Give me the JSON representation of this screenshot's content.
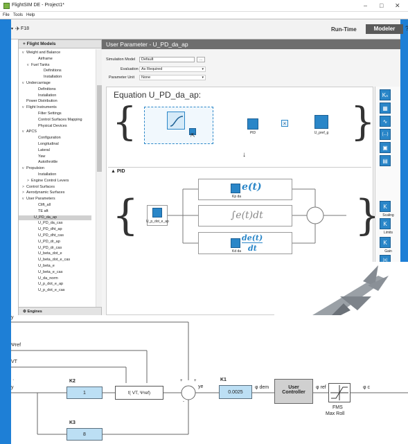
{
  "window": {
    "title": "FlightSIM DE - Project1*",
    "minimize": "–",
    "maximize": "□",
    "close": "✕"
  },
  "menu": {
    "file": "File",
    "tools": "Tools",
    "help": "Help"
  },
  "toolbar": {
    "project": "F18",
    "runtime": "Run-Time",
    "modeler": "Modeler",
    "help_icon": "?"
  },
  "sidebar": {
    "header": "Flight Models",
    "footer": "Engines",
    "items": [
      {
        "label": "Weight and Balance",
        "level": 1,
        "toggle": "v"
      },
      {
        "label": "Airframe",
        "level": 3,
        "toggle": ""
      },
      {
        "label": "Fuel Tanks",
        "level": 2,
        "toggle": "v"
      },
      {
        "label": "Definitions",
        "level": 4,
        "toggle": ""
      },
      {
        "label": "Installation",
        "level": 4,
        "toggle": ""
      },
      {
        "label": "Undercarriage",
        "level": 1,
        "toggle": "v"
      },
      {
        "label": "Definitions",
        "level": 3,
        "toggle": ""
      },
      {
        "label": "Installation",
        "level": 3,
        "toggle": ""
      },
      {
        "label": "Power Distribution",
        "level": 1,
        "toggle": ""
      },
      {
        "label": "Flight Instruments",
        "level": 1,
        "toggle": "v"
      },
      {
        "label": "Filter Settings",
        "level": 3,
        "toggle": ""
      },
      {
        "label": "Control Surfaces Mapping",
        "level": 3,
        "toggle": ""
      },
      {
        "label": "Physical Devices",
        "level": 3,
        "toggle": ""
      },
      {
        "label": "APCS",
        "level": 1,
        "toggle": "v"
      },
      {
        "label": "Configuration",
        "level": 3,
        "toggle": ""
      },
      {
        "label": "Longitudinal",
        "level": 3,
        "toggle": ""
      },
      {
        "label": "Lateral",
        "level": 3,
        "toggle": ""
      },
      {
        "label": "Yaw",
        "level": 3,
        "toggle": ""
      },
      {
        "label": "Autothrottle",
        "level": 3,
        "toggle": ""
      },
      {
        "label": "Propulsion",
        "level": 1,
        "toggle": "v"
      },
      {
        "label": "Installation",
        "level": 3,
        "toggle": ""
      },
      {
        "label": "Engine Control Levers",
        "level": 2,
        "toggle": ">"
      },
      {
        "label": "Control Surfaces",
        "level": 1,
        "toggle": ">"
      },
      {
        "label": "Aerodynamic Surfaces",
        "level": 1,
        "toggle": ">"
      },
      {
        "label": "User Parameters",
        "level": 1,
        "toggle": "v"
      },
      {
        "label": "Clift_all",
        "level": 3,
        "toggle": ""
      },
      {
        "label": "TE aft",
        "level": 3,
        "toggle": ""
      },
      {
        "label": "U_PD_da_ap",
        "level": 3,
        "toggle": "",
        "selected": true
      },
      {
        "label": "U_PD_da_cas",
        "level": 3,
        "toggle": ""
      },
      {
        "label": "U_PD_dht_ap",
        "level": 3,
        "toggle": ""
      },
      {
        "label": "U_PD_dht_cas",
        "level": 3,
        "toggle": ""
      },
      {
        "label": "U_PD_dr_ap",
        "level": 3,
        "toggle": ""
      },
      {
        "label": "U_PD_dr_cas",
        "level": 3,
        "toggle": ""
      },
      {
        "label": "U_beta_dot_e",
        "level": 3,
        "toggle": ""
      },
      {
        "label": "U_beta_dot_e_cas",
        "level": 3,
        "toggle": ""
      },
      {
        "label": "U_beta_e",
        "level": 3,
        "toggle": ""
      },
      {
        "label": "U_beta_e_cas",
        "level": 3,
        "toggle": ""
      },
      {
        "label": "U_da_norm",
        "level": 3,
        "toggle": ""
      },
      {
        "label": "U_p_dot_e_ap",
        "level": 3,
        "toggle": ""
      },
      {
        "label": "U_p_dot_e_cas",
        "level": 3,
        "toggle": ""
      }
    ]
  },
  "panel": {
    "header": "User Parameter - U_PD_da_ap",
    "sim_model_label": "Simulation Model",
    "sim_model_value": "Default",
    "browse": "...",
    "evaluation_label": "Evaluation",
    "evaluation_value": "As Required",
    "unit_label": "Parameter Unit",
    "unit_value": "None",
    "equation_title": "Equation U_PD_da_ap:",
    "pid_block": "PID",
    "uref_block": "U_pref_g",
    "pid_section": "PID",
    "input_block": "U_p_dot_e_ap",
    "kp_label": "Kp da",
    "kd_label": "Kd da",
    "kp_expr": "e(t)",
    "ki_expr": "∫e(t)dt",
    "kd_num": "de(t)",
    "kd_den": "dt",
    "plus": "+"
  },
  "right_tools": {
    "k0": "Kₙ",
    "scaling": "Scaling",
    "limits": "Limits",
    "gain": "Gain",
    "k": "K",
    "x": "|x|",
    "dots": "(...)"
  },
  "diagram": {
    "y_top": "y",
    "psi_ref": "Ψref",
    "vt": "VT",
    "ydot": "·",
    "y_in": "y",
    "k2_label": "K2",
    "k2_value": "1",
    "k3_label": "K3",
    "k3_value": "8",
    "func": "f( VT, Ψref)",
    "ye": "ye",
    "k1_label": "K1",
    "k1_value": "0.0025",
    "phi_dem": "φ dem",
    "user_controller_1": "User",
    "user_controller_2": "Controller",
    "phi_ref": "φ ref",
    "fms1": "FMS",
    "fms2": "Max Roll",
    "phi_c": "φ c",
    "plus1": "+",
    "plus2": "+",
    "minus": "-"
  }
}
